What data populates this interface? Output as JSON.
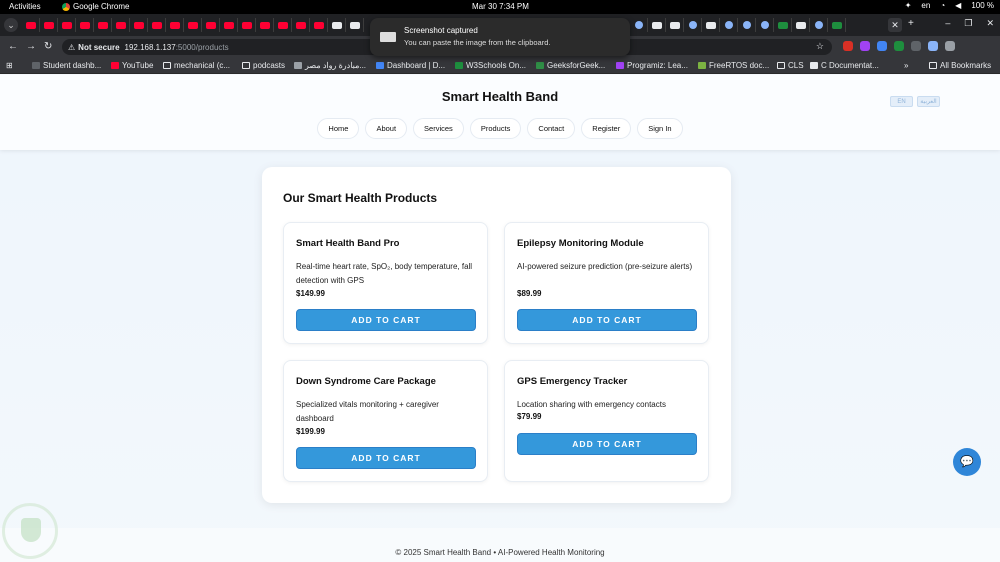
{
  "topbar": {
    "activities": "Activities",
    "app": "Google Chrome",
    "clock": "Mar 30  7:34 PM",
    "lang": "en",
    "battery": "100 %"
  },
  "notification": {
    "title": "Screenshot captured",
    "body": "You can paste the image from the clipboard."
  },
  "address": {
    "security": "Not secure",
    "host": "192.168.1.137",
    "path": ":5000/products"
  },
  "bookmarks": [
    "Student dashb...",
    "YouTube",
    "mechanical (c...",
    "podcasts",
    "مبادرة رواد مصر...",
    "Dashboard | D...",
    "W3Schools On...",
    "GeeksforGeek...",
    "Programiz: Lea...",
    "FreeRTOS doc...",
    "CLS",
    "C Documentat...",
    "All Bookmarks"
  ],
  "site": {
    "brand": "Smart Health Band",
    "lang_en": "EN",
    "lang_ar": "العربية",
    "nav": [
      "Home",
      "About",
      "Services",
      "Products",
      "Contact",
      "Register",
      "Sign In"
    ]
  },
  "products_heading": "Our Smart Health Products",
  "products": [
    {
      "name": "Smart Health Band Pro",
      "desc": "Real-time heart rate, SpO₂, body temperature, fall detection with GPS",
      "price": "$149.99",
      "button": "ADD TO CART"
    },
    {
      "name": "Epilepsy Monitoring Module",
      "desc": "AI-powered seizure prediction (pre-seizure alerts)",
      "price": "$89.99",
      "button": "ADD TO CART"
    },
    {
      "name": "Down Syndrome Care Package",
      "desc": "Specialized vitals monitoring + caregiver dashboard",
      "price": "$199.99",
      "button": "ADD TO CART"
    },
    {
      "name": "GPS Emergency Tracker",
      "desc": "Location sharing with emergency contacts",
      "price": "$79.99",
      "button": "ADD TO CART"
    }
  ],
  "footer": "© 2025 Smart Health Band • AI-Powered Health Monitoring",
  "icons": {
    "chat": "chat-bubble-icon",
    "star": "bookmark-star-icon",
    "back": "back-arrow-icon",
    "forward": "forward-arrow-icon",
    "reload": "reload-icon"
  },
  "colors": {
    "accent": "#3498db",
    "tab_favicon": "#ff0033",
    "page_bg": "#eef5fc"
  }
}
